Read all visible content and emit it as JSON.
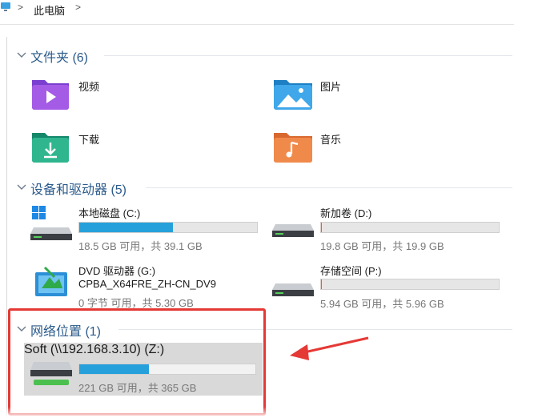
{
  "address_bar": {
    "root_icon": "this-pc-icon",
    "separator": ">",
    "current": "此电脑",
    "trailing_separator": ">"
  },
  "groups": {
    "folders": {
      "label": "文件夹 (6)",
      "items": [
        {
          "name": "视频",
          "icon": "videos-folder-icon"
        },
        {
          "name": "图片",
          "icon": "pictures-folder-icon"
        },
        {
          "name": "下载",
          "icon": "downloads-folder-icon"
        },
        {
          "name": "音乐",
          "icon": "music-folder-icon"
        }
      ]
    },
    "drives": {
      "label": "设备和驱动器 (5)",
      "items": [
        {
          "name": "本地磁盘 (C:)",
          "stats": "18.5 GB 可用，共 39.1 GB",
          "used_fraction": 0.527,
          "icon": "windows-drive-icon"
        },
        {
          "name": "新加卷 (D:)",
          "stats": "19.8 GB 可用，共 19.9 GB",
          "used_fraction": 0.005,
          "icon": "drive-icon"
        },
        {
          "name": "DVD 驱动器 (G:)",
          "subtitle": "CPBA_X64FRE_ZH-CN_DV9",
          "stats": "0 字节 可用，共 5.30 GB",
          "icon": "dvd-drive-icon"
        },
        {
          "name": "存储空间 (P:)",
          "stats": "5.94 GB 可用，共 5.96 GB",
          "used_fraction": 0.003,
          "icon": "drive-icon"
        }
      ]
    },
    "network": {
      "label": "网络位置 (1)",
      "items": [
        {
          "name": "Soft (\\\\192.168.3.10) (Z:)",
          "stats": "221 GB 可用，共 365 GB",
          "used_fraction": 0.395,
          "icon": "network-drive-icon"
        }
      ]
    }
  },
  "colors": {
    "group_label": "#2a5a8a",
    "bar_fill": "#26a0da",
    "highlight": "#e53935"
  }
}
